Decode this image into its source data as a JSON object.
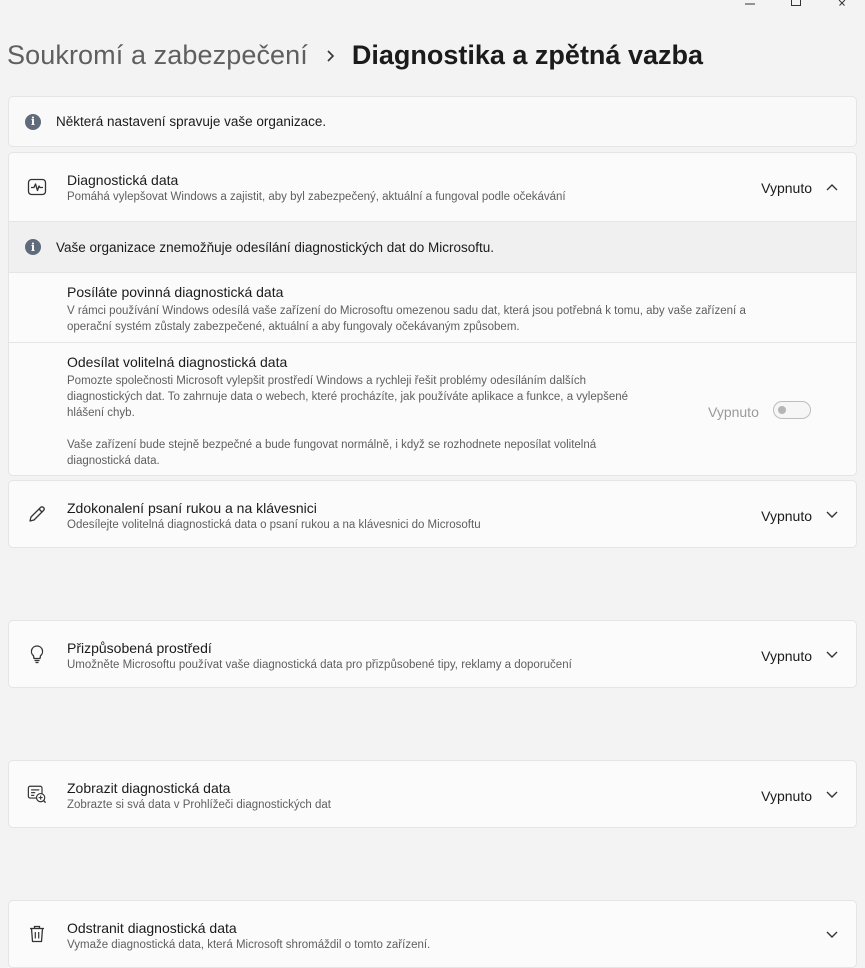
{
  "window": {
    "minimize_icon": "minimize-icon",
    "maximize_icon": "maximize-icon",
    "close_icon": "close-icon"
  },
  "breadcrumb": {
    "parent": "Soukromí a zabezpečení",
    "current": "Diagnostika a zpětná vazba"
  },
  "org_notice": "Některá nastavení spravuje vaše organizace.",
  "diagnostic_data": {
    "title": "Diagnostická data",
    "description": "Pomáhá vylepšovat Windows a zajistit, aby byl zabezpečený, aktuální a fungoval podle očekávání",
    "value": "Vypnuto",
    "expanded": true,
    "icon": "heart-rate-icon",
    "notice": "Vaše organizace znemožňuje odesílání diagnostických dat do Microsoftu.",
    "required": {
      "title": "Posíláte povinná diagnostická data",
      "description_line1": "V rámci používání Windows odesílá vaše zařízení do Microsoftu omezenou sadu dat, která jsou potřebná k tomu, aby vaše zařízení a",
      "description_line2": "operační systém zůstaly zabezpečené, aktuální a aby fungovaly očekávaným způsobem."
    },
    "optional": {
      "title": "Odesílat volitelná diagnostická data",
      "description_line1": "Pomozte společnosti Microsoft vylepšit prostředí Windows a rychleji řešit problémy odesíláním dalších",
      "description_line2": "diagnostických dat. To zahrnuje data o webech, které procházíte, jak používáte aplikace a funkce, a vylepšené",
      "description_line3": "hlášení chyb.",
      "note_line1": "Vaše zařízení bude stejně bezpečné a bude fungovat normálně, i když se rozhodnete neposílat volitelná",
      "note_line2": "diagnostická data.",
      "toggle_label": "Vypnuto",
      "toggle_on": false,
      "toggle_disabled": true
    }
  },
  "settings": [
    {
      "title": "Zdokonalení psaní rukou a na klávesnici",
      "description": "Odesílejte volitelná diagnostická data o psaní rukou a na klávesnici do Microsoftu",
      "value": "Vypnuto",
      "icon": "pen-icon"
    },
    {
      "title": "Přizpůsobená prostředí",
      "description": "Umožněte Microsoftu používat vaše diagnostická data pro přizpůsobené tipy, reklamy a doporučení",
      "value": "Vypnuto",
      "icon": "lightbulb-icon"
    },
    {
      "title": "Zobrazit diagnostická data",
      "description": "Zobrazte si svá data v Prohlížeči diagnostických dat",
      "value": "Vypnuto",
      "icon": "data-viewer-icon"
    },
    {
      "title": "Odstranit diagnostická data",
      "description": "Vymaže diagnostická data, která Microsoft shromáždil o tomto zařízení.",
      "value": "",
      "icon": "trash-icon"
    }
  ]
}
